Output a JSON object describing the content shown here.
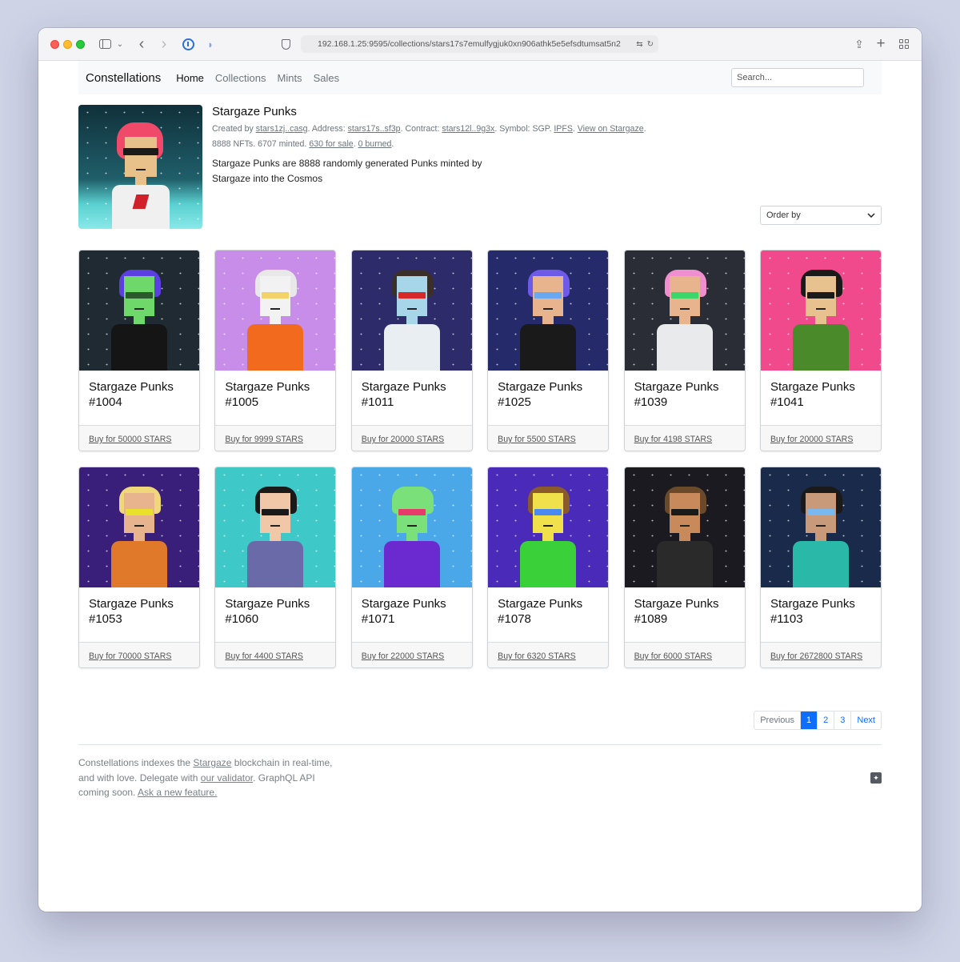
{
  "browser": {
    "url": "192.168.1.25:9595/collections/stars17s7emulfygjuk0xn906athk5e5efsdtumsat5n2"
  },
  "nav": {
    "brand": "Constellations",
    "links": [
      "Home",
      "Collections",
      "Mints",
      "Sales"
    ],
    "search_placeholder": "Search..."
  },
  "collection": {
    "title": "Stargaze Punks",
    "created_by_label": "Created by",
    "creator": "stars1zj..casg",
    "address_label": ". Address:",
    "address": "stars17s..sf3p",
    "contract_label": ". Contract:",
    "contract": "stars12l..9g3x",
    "symbol_text": ". Symbol: SGP.",
    "ipfs": "IPFS",
    "sep": ".",
    "view_link": "View on Stargaze",
    "end": ".",
    "counts_text": "8888 NFTs. 6707 minted.",
    "for_sale": "630 for sale",
    "burned": "0 burned",
    "description": "Stargaze Punks are 8888 randomly generated Punks minted by Stargaze into the Cosmos"
  },
  "order_by": {
    "label": "Order by",
    "icon": "chevron-down-icon"
  },
  "cards": [
    {
      "title": "Stargaze Punks #1004",
      "buy": "Buy for 50000 STARS",
      "bg": "#1f2a33",
      "skin": "#6fd86a",
      "hair": "#5b3fe0",
      "shirt": "#151515",
      "eyes": "#2c5a2e"
    },
    {
      "title": "Stargaze Punks #1005",
      "buy": "Buy for 9999 STARS",
      "bg": "#c88de8",
      "skin": "#f2f2f2",
      "hair": "#e8e8e8",
      "shirt": "#f26a1e",
      "eyes": "#f3d26a"
    },
    {
      "title": "Stargaze Punks #1011",
      "buy": "Buy for 20000 STARS",
      "bg": "#2d2b6a",
      "skin": "#a6d6e8",
      "hair": "#3b2f2a",
      "shirt": "#e8eef2",
      "eyes": "#d62a2a"
    },
    {
      "title": "Stargaze Punks #1025",
      "buy": "Buy for 5500 STARS",
      "bg": "#252a6a",
      "skin": "#e8b48e",
      "hair": "#6d5be8",
      "shirt": "#1a1a1a",
      "eyes": "#6aa8f0"
    },
    {
      "title": "Stargaze Punks #1039",
      "buy": "Buy for 4198 STARS",
      "bg": "#2a2d36",
      "skin": "#e8b48e",
      "hair": "#f08fd0",
      "shirt": "#e8eaec",
      "eyes": "#3ad66a"
    },
    {
      "title": "Stargaze Punks #1041",
      "buy": "Buy for 20000 STARS",
      "bg": "#f04a8c",
      "skin": "#e8c28e",
      "hair": "#1a1a1a",
      "shirt": "#4a8a2a",
      "eyes": "#1a1a1a"
    },
    {
      "title": "Stargaze Punks #1053",
      "buy": "Buy for 70000 STARS",
      "bg": "#3a1f7a",
      "skin": "#e8b48e",
      "hair": "#f0d87a",
      "shirt": "#e07a2a",
      "eyes": "#e8e02a"
    },
    {
      "title": "Stargaze Punks #1060",
      "buy": "Buy for 4400 STARS",
      "bg": "#3ec8c8",
      "skin": "#f0c8a8",
      "hair": "#1a1a1a",
      "shirt": "#6a6aa8",
      "eyes": "#1a1a1a"
    },
    {
      "title": "Stargaze Punks #1071",
      "buy": "Buy for 22000 STARS",
      "bg": "#4aa8e8",
      "skin": "#7ae07a",
      "hair": "#7ae07a",
      "shirt": "#6a2ad0",
      "eyes": "#e83a6a"
    },
    {
      "title": "Stargaze Punks #1078",
      "buy": "Buy for 6320 STARS",
      "bg": "#4a2ab8",
      "skin": "#f0e04a",
      "hair": "#8a5a2a",
      "shirt": "#3ad03a",
      "eyes": "#4a8af0"
    },
    {
      "title": "Stargaze Punks #1089",
      "buy": "Buy for 6000 STARS",
      "bg": "#1a1a20",
      "skin": "#c88a5a",
      "hair": "#6a4a2a",
      "shirt": "#2a2a2a",
      "eyes": "#1a1a1a"
    },
    {
      "title": "Stargaze Punks #1103",
      "buy": "Buy for 2672800 STARS",
      "bg": "#1a2a4a",
      "skin": "#c89a7a",
      "hair": "#1a1a1a",
      "shirt": "#2ab8a8",
      "eyes": "#7ab8f0"
    }
  ],
  "pagination": [
    "Previous",
    "1",
    "2",
    "3",
    "Next"
  ],
  "footer": {
    "t1": "Constellations indexes the ",
    "stargaze_link": "Stargaze",
    "t2": " blockchain in real-time, and with love. Delegate with ",
    "validator_link": "our validator",
    "t3": ". GraphQL API coming soon. ",
    "feature_link": "Ask a new feature.",
    "twitter_icon": "twitter-icon"
  }
}
